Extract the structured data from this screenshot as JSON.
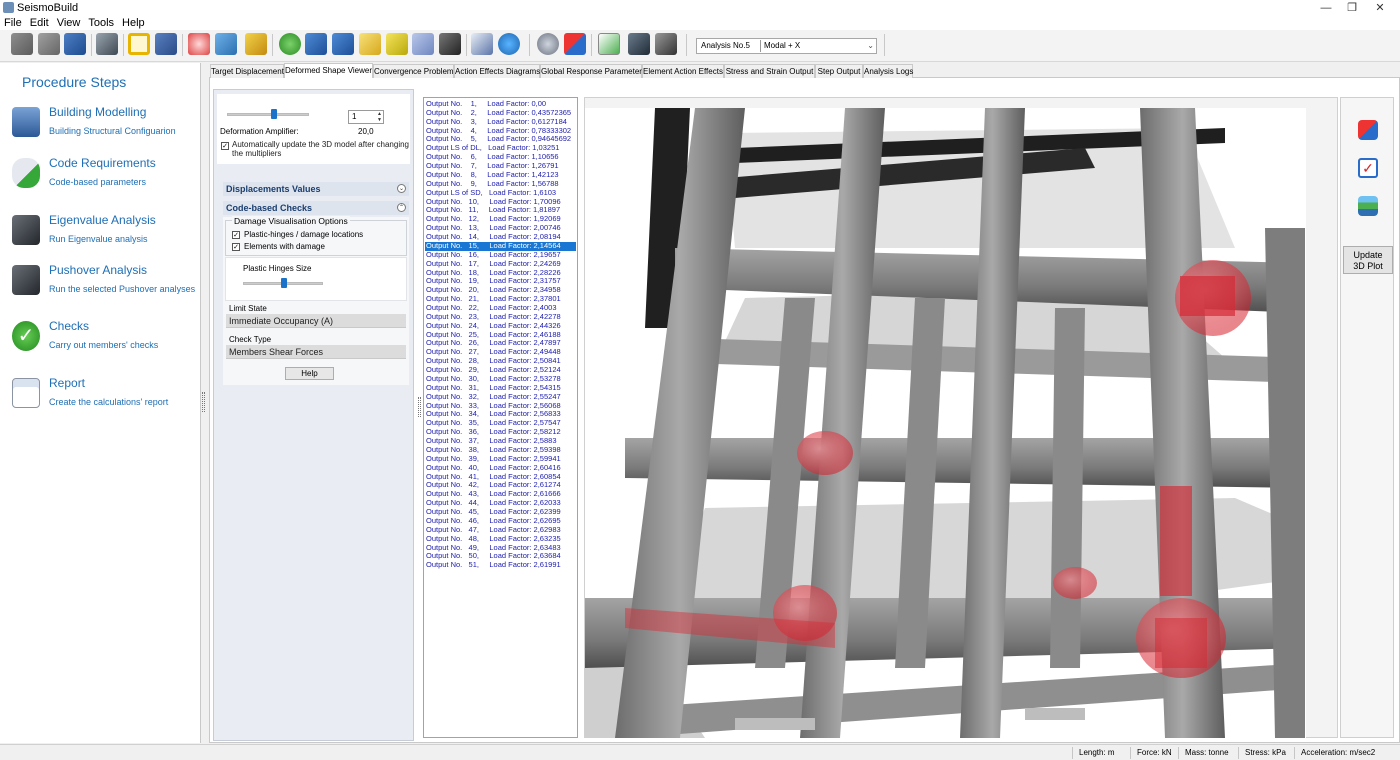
{
  "app": {
    "title": "SeismoBuild"
  },
  "menu": [
    "File",
    "Edit",
    "View",
    "Tools",
    "Help"
  ],
  "toolbar": {
    "analysis_select": "Analysis No.5",
    "analysis_mode": "Modal  + X"
  },
  "procedure": {
    "title": "Procedure Steps",
    "steps": [
      {
        "label": "Building Modelling",
        "desc": "Building Structural Configuarion"
      },
      {
        "label": "Code Requirements",
        "desc": "Code-based parameters"
      },
      {
        "label": "Eigenvalue Analysis",
        "desc": "Run Eigenvalue analysis"
      },
      {
        "label": "Pushover Analysis",
        "desc": "Run the selected Pushover analyses"
      },
      {
        "label": "Checks",
        "desc": "Carry out members' checks"
      },
      {
        "label": "Report",
        "desc": "Create the calculations' report"
      }
    ]
  },
  "tabs": [
    "Target Displacement",
    "Deformed Shape Viewer",
    "Convergence Problems",
    "Action Effects Diagrams",
    "Global Response Parameters",
    "Element Action Effects",
    "Stress and Strain Output",
    "Step Output",
    "Analysis Logs"
  ],
  "active_tab": "Deformed Shape Viewer",
  "options": {
    "spin_value": "1",
    "amplifier_label": "Deformation Amplifier:",
    "amplifier_value": "20,0",
    "auto_update_label": "Automatically update the 3D model after changing the multipliers",
    "auto_update_checked": true,
    "displacements_header": "Displacements Values",
    "checks_header": "Code-based Checks",
    "damage_group": "Damage Visualisation Options",
    "plastic_hinges_label": "Plastic-hinges / damage locations",
    "elements_damage_label": "Elements with damage",
    "hinge_size_label": "Plastic Hinges Size",
    "limit_state_label": "Limit State",
    "limit_state_value": "Immediate Occupancy (A)",
    "check_type_label": "Check Type",
    "check_type_value": "Members Shear Forces",
    "help_label": "Help"
  },
  "outputs": [
    "Output No.    1,     Load Factor: 0,00",
    "Output No.    2,     Load Factor: 0,43572365",
    "Output No.    3,     Load Factor: 0,6127184",
    "Output No.    4,     Load Factor: 0,78333302",
    "Output No.    5,     Load Factor: 0,94645692",
    "Output LS of DL,   Load Factor: 1,03251",
    "Output No.    6,     Load Factor: 1,10656",
    "Output No.    7,     Load Factor: 1,26791",
    "Output No.    8,     Load Factor: 1,42123",
    "Output No.    9,     Load Factor: 1,56788",
    "Output LS of SD,   Load Factor: 1,6103",
    "Output No.   10,     Load Factor: 1,70096",
    "Output No.   11,     Load Factor: 1,81897",
    "Output No.   12,     Load Factor: 1,92069",
    "Output No.   13,     Load Factor: 2,00746",
    "Output No.   14,     Load Factor: 2,08194",
    "Output No.   15,     Load Factor: 2,14564",
    "Output No.   16,     Load Factor: 2,19657",
    "Output No.   17,     Load Factor: 2,24269",
    "Output No.   18,     Load Factor: 2,28226",
    "Output No.   19,     Load Factor: 2,31757",
    "Output No.   20,     Load Factor: 2,34958",
    "Output No.   21,     Load Factor: 2,37801",
    "Output No.   22,     Load Factor: 2,4003",
    "Output No.   23,     Load Factor: 2,42278",
    "Output No.   24,     Load Factor: 2,44326",
    "Output No.   25,     Load Factor: 2,46188",
    "Output No.   26,     Load Factor: 2,47897",
    "Output No.   27,     Load Factor: 2,49448",
    "Output No.   28,     Load Factor: 2,50841",
    "Output No.   29,     Load Factor: 2,52124",
    "Output No.   30,     Load Factor: 2,53278",
    "Output No.   31,     Load Factor: 2,54315",
    "Output No.   32,     Load Factor: 2,55247",
    "Output No.   33,     Load Factor: 2,56068",
    "Output No.   34,     Load Factor: 2,56833",
    "Output No.   35,     Load Factor: 2,57547",
    "Output No.   36,     Load Factor: 2,58212",
    "Output No.   37,     Load Factor: 2,5883",
    "Output No.   38,     Load Factor: 2,59398",
    "Output No.   39,     Load Factor: 2,59941",
    "Output No.   40,     Load Factor: 2,60416",
    "Output No.   41,     Load Factor: 2,60854",
    "Output No.   42,     Load Factor: 2,61274",
    "Output No.   43,     Load Factor: 2,61666",
    "Output No.   44,     Load Factor: 2,62033",
    "Output No.   45,     Load Factor: 2,62399",
    "Output No.   46,     Load Factor: 2,62695",
    "Output No.   47,     Load Factor: 2,62983",
    "Output No.   48,     Load Factor: 2,63235",
    "Output No.   49,     Load Factor: 2,63483",
    "Output No.   50,     Load Factor: 2,63684",
    "Output No.   51,     Load Factor: 2,61991"
  ],
  "selected_output": "Output No.   15,     Load Factor: 2,14564",
  "right_panel": {
    "update_label": "Update\n3D Plot"
  },
  "status": {
    "length": "Length: m",
    "force": "Force: kN",
    "mass": "Mass: tonne",
    "stress": "Stress: kPa",
    "acceleration": "Acceleration: m/sec2"
  },
  "colors": {
    "accent": "#1e6fb5",
    "selection": "#1976d2",
    "damage": "#e0303a"
  }
}
